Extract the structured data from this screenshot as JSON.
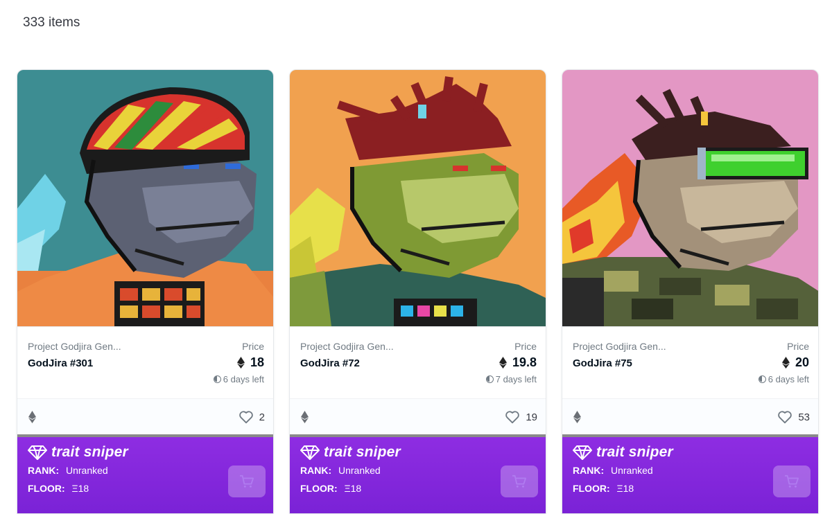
{
  "header": {
    "item_count": "333 items"
  },
  "cards": [
    {
      "collection": "Project Godjira Gen...",
      "name": "GodJira #301",
      "price_label": "Price",
      "price": "18",
      "time_left": "6 days left",
      "likes": "2",
      "background": "#3d8d92",
      "sniper": {
        "brand": "trait sniper",
        "rank_label": "RANK:",
        "rank": "Unranked",
        "floor_label": "FLOOR:",
        "floor": "Ξ18"
      }
    },
    {
      "collection": "Project Godjira Gen...",
      "name": "GodJira #72",
      "price_label": "Price",
      "price": "19.8",
      "time_left": "7 days left",
      "likes": "19",
      "background": "#f1a14f",
      "sniper": {
        "brand": "trait sniper",
        "rank_label": "RANK:",
        "rank": "Unranked",
        "floor_label": "FLOOR:",
        "floor": "Ξ18"
      }
    },
    {
      "collection": "Project Godjira Gen...",
      "name": "GodJira #75",
      "price_label": "Price",
      "price": "20",
      "time_left": "6 days left",
      "likes": "53",
      "background": "#e397c4",
      "sniper": {
        "brand": "trait sniper",
        "rank_label": "RANK:",
        "rank": "Unranked",
        "floor_label": "FLOOR:",
        "floor": "Ξ18"
      }
    }
  ],
  "icons": {
    "currency": "ethereum-icon",
    "time": "clock-icon",
    "favorite": "heart-icon",
    "brand": "diamond-icon",
    "buy": "cart-icon"
  }
}
